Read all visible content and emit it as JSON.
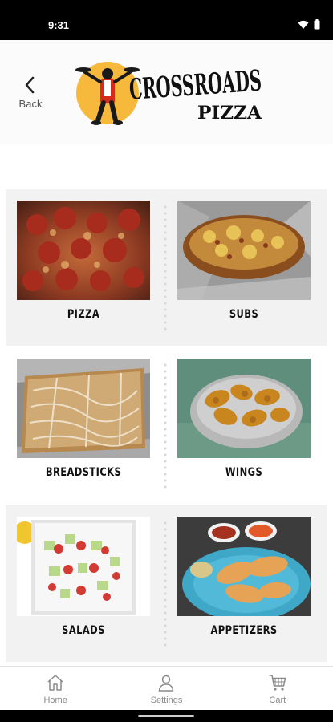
{
  "status_bar": {
    "time": "9:31",
    "icons": [
      "wifi-icon",
      "battery-icon"
    ]
  },
  "header": {
    "back_label": "Back",
    "logo": {
      "line1": "CROSSROADS",
      "line2": "PIZZA",
      "circle_color": "#f6b93b"
    }
  },
  "menu": {
    "categories": [
      {
        "label": "PIZZA",
        "image": "pizza-photo"
      },
      {
        "label": "SUBS",
        "image": "subs-photo"
      },
      {
        "label": "BREADSTICKS",
        "image": "breadsticks-photo"
      },
      {
        "label": "WINGS",
        "image": "wings-photo"
      },
      {
        "label": "SALADS",
        "image": "salads-photo"
      },
      {
        "label": "APPETIZERS",
        "image": "appetizers-photo"
      }
    ]
  },
  "bottom_nav": {
    "items": [
      {
        "label": "Home",
        "icon": "home-icon"
      },
      {
        "label": "Settings",
        "icon": "person-icon"
      },
      {
        "label": "Cart",
        "icon": "cart-icon"
      }
    ]
  }
}
